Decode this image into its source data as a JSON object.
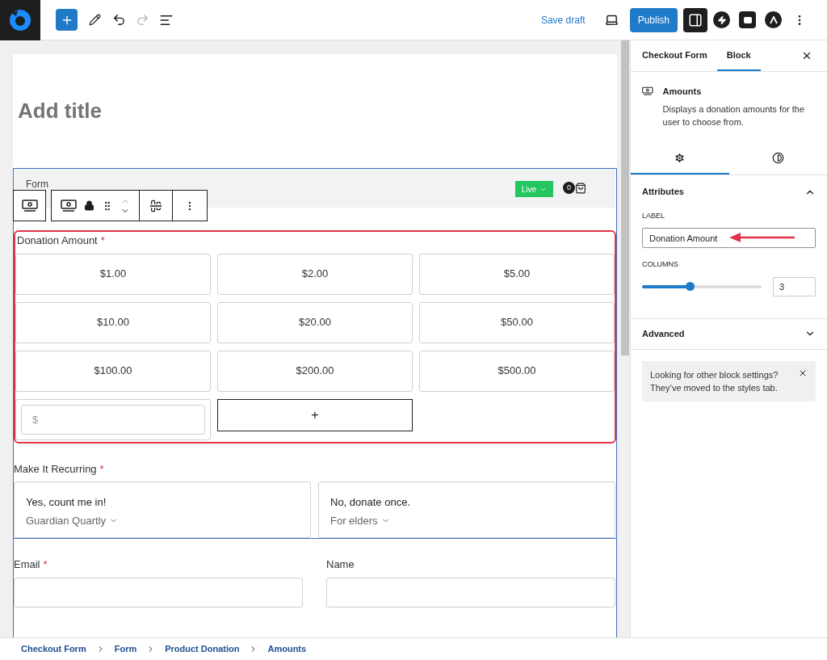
{
  "topbar": {
    "save_draft": "Save draft",
    "publish": "Publish"
  },
  "title_placeholder": "Add title",
  "form": {
    "label": "Form",
    "status": "Live",
    "count": "0"
  },
  "amounts": {
    "label": "Donation Amount",
    "required_mark": "*",
    "options": [
      "$1.00",
      "$2.00",
      "$5.00",
      "$10.00",
      "$20.00",
      "$50.00",
      "$100.00",
      "$200.00",
      "$500.00"
    ],
    "custom_placeholder": "$",
    "add": "+"
  },
  "recurring": {
    "label": "Make It Recurring",
    "required_mark": "*",
    "options": [
      {
        "title": "Yes, count me in!",
        "subtitle": "Guardian Quartly"
      },
      {
        "title": "No, donate once.",
        "subtitle": "For elders"
      }
    ]
  },
  "fields": [
    {
      "label": "Email",
      "required_mark": "*"
    },
    {
      "label": "Name"
    }
  ],
  "sidebar": {
    "tabs": [
      {
        "label": "Checkout Form",
        "selected": false
      },
      {
        "label": "Block",
        "selected": true
      }
    ],
    "block": {
      "title": "Amounts",
      "description": "Displays a donation amounts for the user to choose from."
    },
    "icon_tabs": [
      {
        "kind": "settings",
        "selected": true
      },
      {
        "kind": "styles",
        "selected": false
      }
    ],
    "attributes": {
      "title": "Attributes",
      "expanded": true,
      "label_caption": "LABEL",
      "label_value": "Donation Amount",
      "columns_caption": "COLUMNS",
      "level": 0.4,
      "columns_value": "3"
    },
    "advanced": {
      "title": "Advanced",
      "expanded": false
    },
    "notice": "Looking for other block settings? They’ve moved to the styles tab."
  },
  "breadcrumbs": [
    "Checkout Form",
    "Form",
    "Product Donation",
    "Amounts"
  ]
}
